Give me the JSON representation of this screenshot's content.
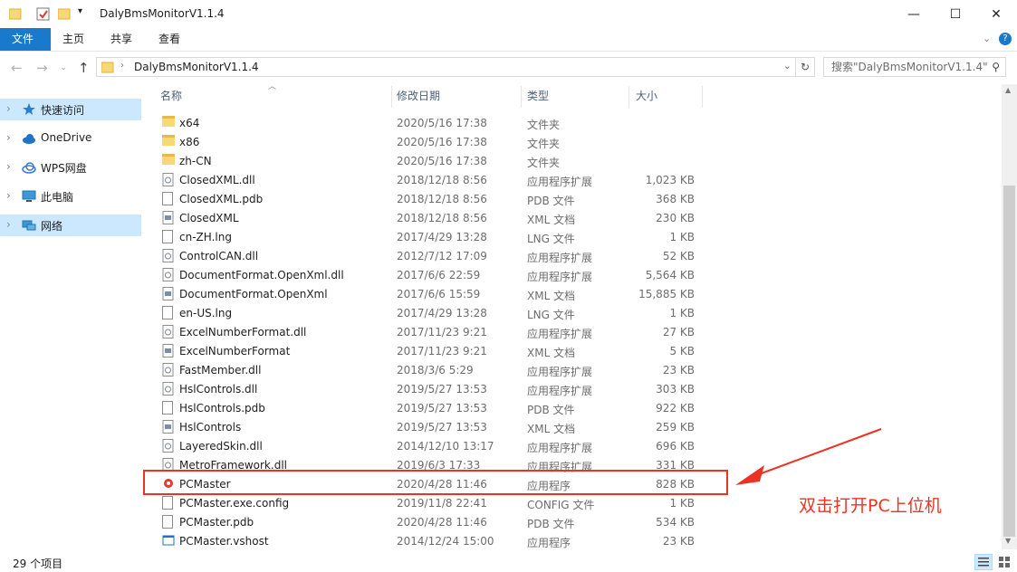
{
  "window": {
    "title": "DalyBmsMonitorV1.1.4"
  },
  "ribbon": {
    "tabs": [
      "文件",
      "主页",
      "共享",
      "查看"
    ]
  },
  "address": {
    "path": "DalyBmsMonitorV1.1.4",
    "search_placeholder": "搜索\"DalyBmsMonitorV1.1.4\""
  },
  "nav": {
    "items": [
      {
        "label": "快速访问",
        "icon": "star-icon"
      },
      {
        "label": "OneDrive",
        "icon": "cloud-icon"
      },
      {
        "label": "WPS网盘",
        "icon": "cloud-icon"
      },
      {
        "label": "此电脑",
        "icon": "computer-icon"
      },
      {
        "label": "网络",
        "icon": "network-icon"
      }
    ]
  },
  "columns": {
    "name": "名称",
    "date": "修改日期",
    "type": "类型",
    "size": "大小"
  },
  "files": [
    {
      "name": "x64",
      "date": "2020/5/16 17:38",
      "type": "文件夹",
      "size": "",
      "kind": "folder"
    },
    {
      "name": "x86",
      "date": "2020/5/16 17:38",
      "type": "文件夹",
      "size": "",
      "kind": "folder"
    },
    {
      "name": "zh-CN",
      "date": "2020/5/16 17:38",
      "type": "文件夹",
      "size": "",
      "kind": "folder"
    },
    {
      "name": "ClosedXML.dll",
      "date": "2018/12/18 8:56",
      "type": "应用程序扩展",
      "size": "1,023 KB",
      "kind": "dll"
    },
    {
      "name": "ClosedXML.pdb",
      "date": "2018/12/18 8:56",
      "type": "PDB 文件",
      "size": "368 KB",
      "kind": "file"
    },
    {
      "name": "ClosedXML",
      "date": "2018/12/18 8:56",
      "type": "XML 文档",
      "size": "230 KB",
      "kind": "xml"
    },
    {
      "name": "cn-ZH.lng",
      "date": "2017/4/29 13:28",
      "type": "LNG 文件",
      "size": "1 KB",
      "kind": "file"
    },
    {
      "name": "ControlCAN.dll",
      "date": "2012/7/12 17:09",
      "type": "应用程序扩展",
      "size": "52 KB",
      "kind": "dll"
    },
    {
      "name": "DocumentFormat.OpenXml.dll",
      "date": "2017/6/6 22:59",
      "type": "应用程序扩展",
      "size": "5,564 KB",
      "kind": "dll"
    },
    {
      "name": "DocumentFormat.OpenXml",
      "date": "2017/6/6 15:59",
      "type": "XML 文档",
      "size": "15,885 KB",
      "kind": "xml"
    },
    {
      "name": "en-US.lng",
      "date": "2017/4/29 13:28",
      "type": "LNG 文件",
      "size": "1 KB",
      "kind": "file"
    },
    {
      "name": "ExcelNumberFormat.dll",
      "date": "2017/11/23 9:21",
      "type": "应用程序扩展",
      "size": "27 KB",
      "kind": "dll"
    },
    {
      "name": "ExcelNumberFormat",
      "date": "2017/11/23 9:21",
      "type": "XML 文档",
      "size": "5 KB",
      "kind": "xml"
    },
    {
      "name": "FastMember.dll",
      "date": "2018/3/6 5:29",
      "type": "应用程序扩展",
      "size": "23 KB",
      "kind": "dll"
    },
    {
      "name": "HslControls.dll",
      "date": "2019/5/27 13:53",
      "type": "应用程序扩展",
      "size": "303 KB",
      "kind": "dll"
    },
    {
      "name": "HslControls.pdb",
      "date": "2019/5/27 13:53",
      "type": "PDB 文件",
      "size": "922 KB",
      "kind": "file"
    },
    {
      "name": "HslControls",
      "date": "2019/5/27 13:53",
      "type": "XML 文档",
      "size": "259 KB",
      "kind": "xml"
    },
    {
      "name": "LayeredSkin.dll",
      "date": "2014/12/10 13:17",
      "type": "应用程序扩展",
      "size": "696 KB",
      "kind": "dll"
    },
    {
      "name": "MetroFramework.dll",
      "date": "2019/6/3 17:33",
      "type": "应用程序扩展",
      "size": "331 KB",
      "kind": "dll"
    },
    {
      "name": "PCMaster",
      "date": "2020/4/28 11:46",
      "type": "应用程序",
      "size": "828 KB",
      "kind": "exe"
    },
    {
      "name": "PCMaster.exe.config",
      "date": "2019/11/8 22:41",
      "type": "CONFIG 文件",
      "size": "1 KB",
      "kind": "file"
    },
    {
      "name": "PCMaster.pdb",
      "date": "2020/4/28 11:46",
      "type": "PDB 文件",
      "size": "534 KB",
      "kind": "file"
    },
    {
      "name": "PCMaster.vshost",
      "date": "2014/12/24 15:00",
      "type": "应用程序",
      "size": "23 KB",
      "kind": "vshost"
    }
  ],
  "status": {
    "count": "29 个项目"
  },
  "annotation": {
    "text": "双击打开PC上位机",
    "color": "#ea3324"
  }
}
